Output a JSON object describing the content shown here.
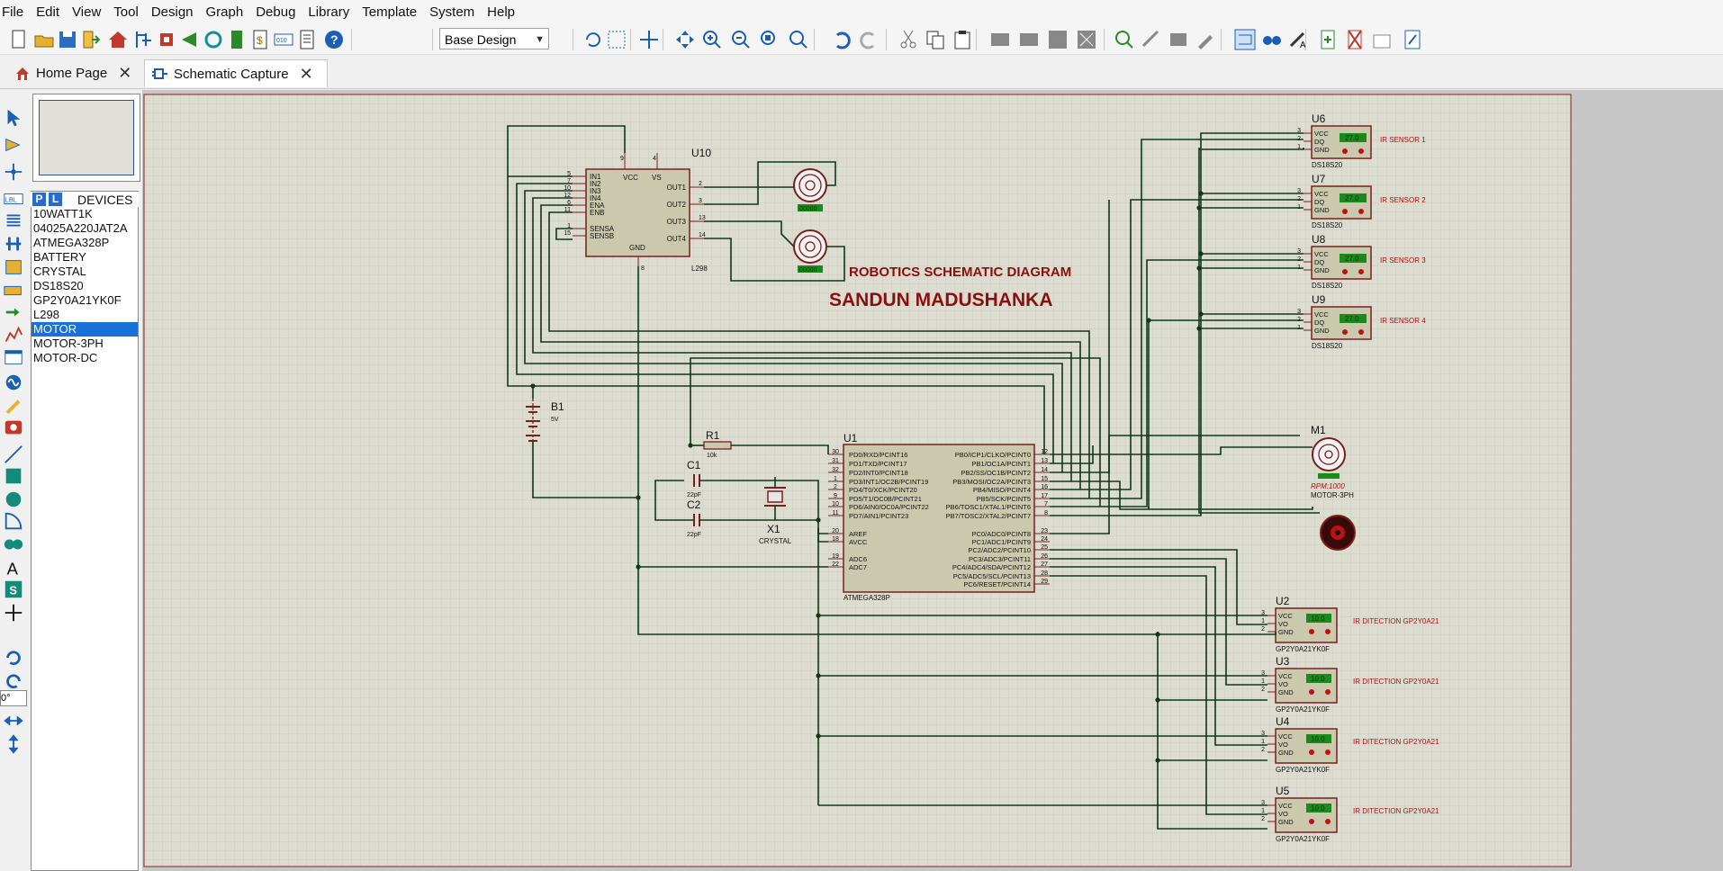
{
  "menu": [
    "File",
    "Edit",
    "View",
    "Tool",
    "Design",
    "Graph",
    "Debug",
    "Library",
    "Template",
    "System",
    "Help"
  ],
  "toolbar": {
    "design_select": "Base Design"
  },
  "tabs": [
    {
      "label": "Home Page"
    },
    {
      "label": "Schematic Capture"
    }
  ],
  "devices": {
    "p_label": "P",
    "l_label": "L",
    "header": "DEVICES",
    "items": [
      "10WATT1K",
      "04025A220JAT2A",
      "ATMEGA328P",
      "BATTERY",
      "CRYSTAL",
      "DS18S20",
      "GP2Y0A21YK0F",
      "L298",
      "MOTOR",
      "MOTOR-3PH",
      "MOTOR-DC"
    ],
    "selected": "MOTOR"
  },
  "left_tools": {
    "angle_value": "0°"
  },
  "schematic": {
    "title": "ROBOTICS SCHEMATIC DIAGRAM",
    "author": "SANDUN MADUSHANKA",
    "u10": {
      "ref": "U10",
      "part": "L298",
      "left_pins": [
        [
          "5",
          "IN1"
        ],
        [
          "7",
          "IN2"
        ],
        [
          "10",
          "IN3"
        ],
        [
          "12",
          "IN4"
        ],
        [
          "6",
          "ENA"
        ],
        [
          "11",
          "ENB"
        ],
        [
          "1",
          "SENSA"
        ],
        [
          "15",
          "SENSB"
        ]
      ],
      "top_pins": [
        [
          "9",
          "VCC"
        ],
        [
          "4",
          "VS"
        ]
      ],
      "right_pins": [
        [
          "2",
          "OUT1"
        ],
        [
          "3",
          "OUT2"
        ],
        [
          "13",
          "OUT3"
        ],
        [
          "14",
          "OUT4"
        ]
      ],
      "bottom": [
        "8",
        "GND"
      ]
    },
    "u1": {
      "ref": "U1",
      "part": "ATMEGA328P",
      "left_pins": [
        [
          "30",
          "PD0/RXD/PCINT16"
        ],
        [
          "31",
          "PD1/TXD/PCINT17"
        ],
        [
          "32",
          "PD2/INT0/PCINT18"
        ],
        [
          "1",
          "PD3/INT1/OC2B/PCINT19"
        ],
        [
          "2",
          "PD4/T0/XCK/PCINT20"
        ],
        [
          "9",
          "PD5/T1/OC0B/PCINT21"
        ],
        [
          "10",
          "PD6/AIN0/OC0A/PCINT22"
        ],
        [
          "11",
          "PD7/AIN1/PCINT23"
        ],
        [
          "20",
          "AREF"
        ],
        [
          "18",
          "AVCC"
        ],
        [
          "19",
          "ADC6"
        ],
        [
          "22",
          "ADC7"
        ]
      ],
      "right_pins": [
        [
          "12",
          "PB0/ICP1/CLKO/PCINT0"
        ],
        [
          "13",
          "PB1/OC1A/PCINT1"
        ],
        [
          "14",
          "PB2/SS/OC1B/PCINT2"
        ],
        [
          "15",
          "PB3/MOSI/OC2A/PCINT3"
        ],
        [
          "16",
          "PB4/MISO/PCINT4"
        ],
        [
          "17",
          "PB5/SCK/PCINT5"
        ],
        [
          "7",
          "PB6/TOSC1/XTAL1/PCINT6"
        ],
        [
          "8",
          "PB7/TOSC2/XTAL2/PCINT7"
        ],
        [
          "23",
          "PC0/ADC0/PCINT8"
        ],
        [
          "24",
          "PC1/ADC1/PCINT9"
        ],
        [
          "25",
          "PC2/ADC2/PCINT10"
        ],
        [
          "26",
          "PC3/ADC3/PCINT11"
        ],
        [
          "27",
          "PC4/ADC4/SDA/PCINT12"
        ],
        [
          "28",
          "PC5/ADC5/SCL/PCINT13"
        ],
        [
          "29",
          "PC6/RESET/PCINT14"
        ]
      ]
    },
    "b1": {
      "ref": "B1",
      "value": "5V"
    },
    "r1": {
      "ref": "R1",
      "value": "10k"
    },
    "c1": {
      "ref": "C1",
      "value": "22pF"
    },
    "c2": {
      "ref": "C2",
      "value": "22pF"
    },
    "x1": {
      "ref": "X1",
      "part": "CRYSTAL"
    },
    "m1": {
      "ref": "M1",
      "rpm": "RPM:1000",
      "part": "MOTOR-3PH"
    },
    "motor_display": "00000",
    "ir_sensors": [
      {
        "ref": "U6",
        "label": "IR SENSOR 1",
        "part": "DS18S20",
        "reading": "27.0"
      },
      {
        "ref": "U7",
        "label": "IR SENSOR 2",
        "part": "DS18S20",
        "reading": "27.0"
      },
      {
        "ref": "U8",
        "label": "IR SENSOR 3",
        "part": "DS18S20",
        "reading": "27.0"
      },
      {
        "ref": "U9",
        "label": "IR SENSOR 4",
        "part": "DS18S20",
        "reading": "27.0"
      }
    ],
    "ds_pins": [
      [
        "3",
        "VCC"
      ],
      [
        "2",
        "DQ"
      ],
      [
        "1",
        "GND"
      ]
    ],
    "gp_sensors": [
      {
        "ref": "U2",
        "label": "IR DITECTION GP2Y0A21",
        "part": "GP2Y0A21YK0F",
        "reading": "10.0"
      },
      {
        "ref": "U3",
        "label": "IR DITECTION GP2Y0A21",
        "part": "GP2Y0A21YK0F",
        "reading": "10.0"
      },
      {
        "ref": "U4",
        "label": "IR DITECTION GP2Y0A21",
        "part": "GP2Y0A21YK0F",
        "reading": "10.0"
      },
      {
        "ref": "U5",
        "label": "IR DITECTION GP2Y0A21",
        "part": "GP2Y0A21YK0F",
        "reading": "10.0"
      }
    ],
    "gp_pins": [
      [
        "3",
        "VCC"
      ],
      [
        "1",
        "VO"
      ],
      [
        "2",
        "GND"
      ]
    ]
  }
}
